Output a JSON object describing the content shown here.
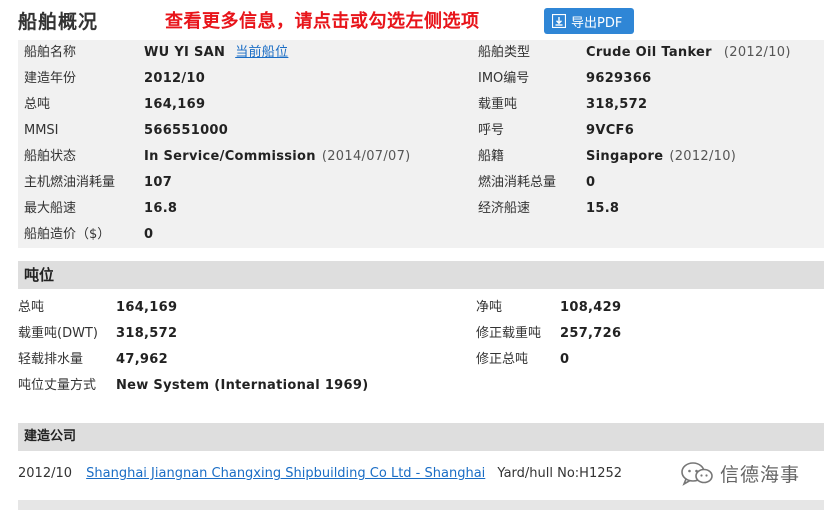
{
  "header": {
    "title": "船舶概况",
    "notice": "查看更多信息，请点击或勾选左侧选项",
    "pdf_button": "导出PDF",
    "pdf_icon": "download-icon"
  },
  "vessel": {
    "left": [
      {
        "label": "船舶名称",
        "value": "WU YI SAN",
        "link": "当前船位"
      },
      {
        "label": "建造年份",
        "value": "2012/10"
      },
      {
        "label": "总吨",
        "value": "164,169"
      },
      {
        "label": "MMSI",
        "value": "566551000"
      },
      {
        "label": "船舶状态",
        "value": "In Service/Commission",
        "sub": "(2014/07/07)"
      },
      {
        "label": "主机燃油消耗量",
        "value": "107"
      },
      {
        "label": "最大船速",
        "value": "16.8"
      },
      {
        "label": "船舶造价（$）",
        "value": "0"
      }
    ],
    "right": [
      {
        "label": "船舶类型",
        "value": "Crude Oil Tanker",
        "sub": "(2012/10)"
      },
      {
        "label": "IMO编号",
        "value": "9629366"
      },
      {
        "label": "载重吨",
        "value": "318,572"
      },
      {
        "label": "呼号",
        "value": "9VCF6"
      },
      {
        "label": "船籍",
        "value": "Singapore",
        "sub": "(2012/10)"
      },
      {
        "label": "燃油消耗总量",
        "value": "0"
      },
      {
        "label": "经济船速",
        "value": "15.8"
      }
    ]
  },
  "tonnage": {
    "title": "吨位",
    "left": [
      {
        "label": "总吨",
        "value": "164,169"
      },
      {
        "label": "载重吨(DWT)",
        "value": "318,572"
      },
      {
        "label": "轻载排水量",
        "value": "47,962"
      },
      {
        "label": "吨位丈量方式",
        "value": "New System (International 1969)"
      }
    ],
    "right": [
      {
        "label": "净吨",
        "value": "108,429"
      },
      {
        "label": "修正载重吨",
        "value": "257,726"
      },
      {
        "label": "修正总吨",
        "value": "0"
      }
    ]
  },
  "builder": {
    "title": "建造公司",
    "date": "2012/10",
    "name": "Shanghai Jiangnan Changxing Shipbuilding Co Ltd - Shanghai",
    "yard": "Yard/hull No:H1252"
  },
  "watermark": {
    "text": "信德海事",
    "icon": "wechat-icon"
  }
}
